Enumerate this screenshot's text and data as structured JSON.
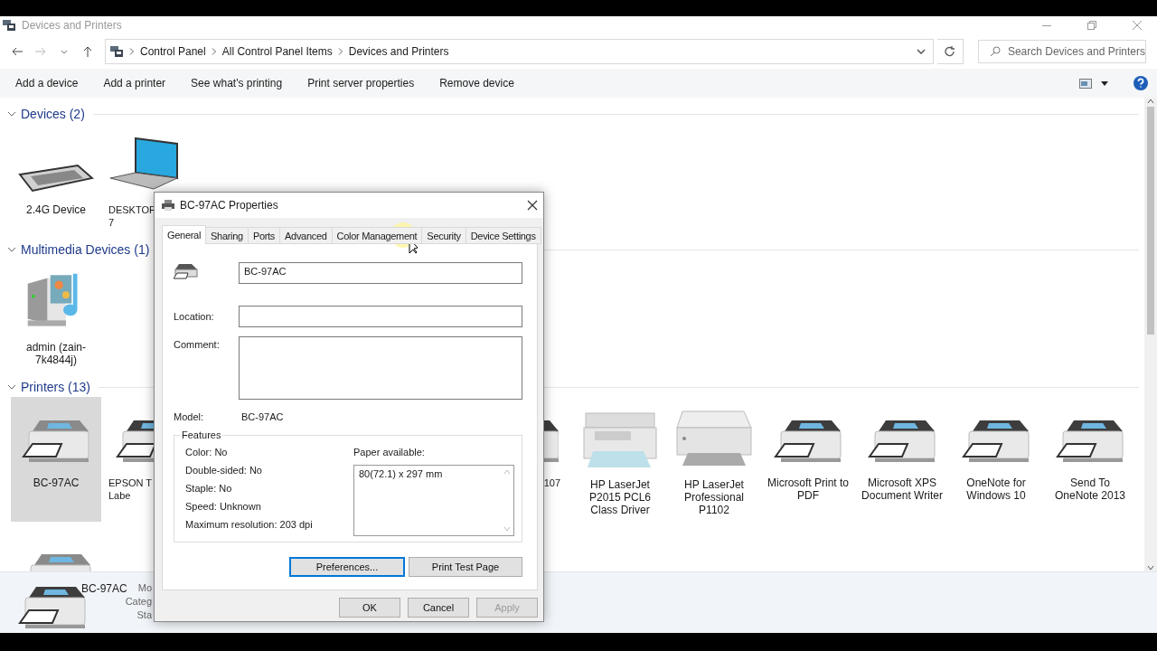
{
  "window": {
    "title": "Devices and Printers"
  },
  "breadcrumb": [
    "Control Panel",
    "All Control Panel Items",
    "Devices and Printers"
  ],
  "search": {
    "placeholder": "Search Devices and Printers"
  },
  "toolbar": [
    "Add a device",
    "Add a printer",
    "See what's printing",
    "Print server properties",
    "Remove device"
  ],
  "groups": [
    {
      "title": "Devices (2)",
      "expanded": true,
      "items": [
        {
          "label": "2.4G Device",
          "kind": "keyboard",
          "selected": false
        },
        {
          "label": "DESKTOP\n7",
          "kind": "laptop",
          "selected": false,
          "covered_right": true
        }
      ]
    },
    {
      "title": "Multimedia Devices (1)",
      "expanded": true,
      "items": [
        {
          "label": "admin (zain-7k4844j)",
          "kind": "media",
          "selected": false
        }
      ]
    },
    {
      "title": "Printers (13)",
      "expanded": true,
      "items": [
        {
          "label": "BC-97AC",
          "kind": "printer_light",
          "selected": true
        },
        {
          "label": "EPSON T\nLabe",
          "kind": "printer_dark",
          "selected": false,
          "covered_right": true
        },
        {
          "label": "107",
          "kind": "printer_dark",
          "selected": false,
          "covered_left": true
        },
        {
          "label": "HP LaserJet P2015 PCL6 Class Driver",
          "kind": "mfp",
          "selected": false
        },
        {
          "label": "HP LaserJet Professional P1102",
          "kind": "laser",
          "selected": false
        },
        {
          "label": "Microsoft Print to PDF",
          "kind": "printer_dark",
          "selected": false
        },
        {
          "label": "Microsoft XPS Document Writer",
          "kind": "printer_dark",
          "selected": false
        },
        {
          "label": "OneNote for Windows 10",
          "kind": "printer_dark",
          "selected": false
        },
        {
          "label": "Send To OneNote 2013",
          "kind": "printer_dark",
          "selected": false
        },
        {
          "kind": "printer_light",
          "selected": false,
          "covered_bottom": true
        }
      ]
    }
  ],
  "details": {
    "name": "BC-97AC",
    "fields": [
      "Mo",
      "Categ",
      "Sta"
    ]
  },
  "dialog": {
    "title": "BC-97AC Properties",
    "tabs": [
      {
        "label": "General",
        "selected": true
      },
      {
        "label": "Sharing",
        "selected": false
      },
      {
        "label": "Ports",
        "selected": false
      },
      {
        "label": "Advanced",
        "selected": false
      },
      {
        "label": "Color Management",
        "selected": false
      },
      {
        "label": "Security",
        "selected": false
      },
      {
        "label": "Device Settings",
        "selected": false
      }
    ],
    "name_value": "BC-97AC",
    "location_label": "Location:",
    "comment_label": "Comment:",
    "model_label": "Model:",
    "model_value": "BC-97AC",
    "features": {
      "title": "Features",
      "items": [
        "Color: No",
        "Double-sided: No",
        "Staple: No",
        "Speed: Unknown",
        "Maximum resolution: 203 dpi"
      ],
      "paper_label": "Paper available:",
      "paper": [
        "80(72.1) x 297 mm"
      ]
    },
    "buttons": [
      {
        "label": "Preferences...",
        "focused": true
      },
      {
        "label": "Print Test Page",
        "focused": false
      }
    ],
    "footer_buttons": [
      {
        "label": "OK",
        "disabled": false
      },
      {
        "label": "Cancel",
        "disabled": false
      },
      {
        "label": "Apply",
        "disabled": true
      }
    ]
  }
}
